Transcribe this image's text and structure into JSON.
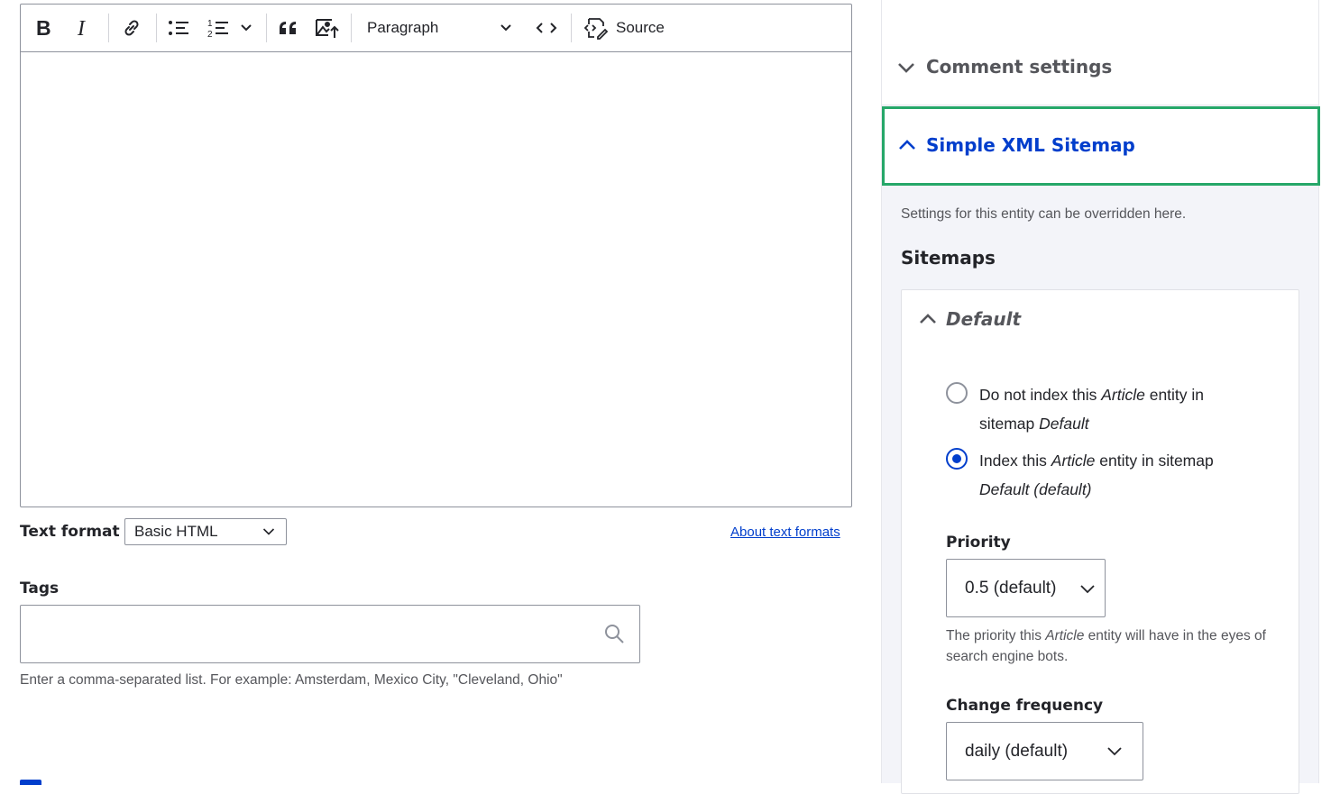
{
  "editor": {
    "toolbar": {
      "paragraph_label": "Paragraph",
      "source_label": "Source",
      "icons": [
        "bold-icon",
        "italic-icon",
        "link-icon",
        "bulleted-list-icon",
        "numbered-list-icon",
        "chevron-down-icon",
        "blockquote-icon",
        "image-upload-icon",
        "chevron-down-icon",
        "code-icon",
        "source-icon"
      ]
    }
  },
  "text_format": {
    "label": "Text format",
    "selected": "Basic HTML",
    "about_link": "About text formats"
  },
  "tags": {
    "label": "Tags",
    "value": "",
    "description": "Enter a comma-separated list. For example: Amsterdam, Mexico City, \"Cleveland, Ohio\""
  },
  "sidebar": {
    "comment_settings": {
      "title": "Comment settings"
    },
    "simple_xml_sitemap": {
      "title": "Simple XML Sitemap",
      "description": "Settings for this entity can be overridden here.",
      "sitemaps_heading": "Sitemaps",
      "default_group": {
        "title": "Default",
        "radio_options": [
          {
            "pre": "Do not index this ",
            "entity": "Article",
            "mid": " entity in sitemap ",
            "sitemap": "Default",
            "post": "",
            "checked": false
          },
          {
            "pre": "Index this ",
            "entity": "Article",
            "mid": " entity in sitemap ",
            "sitemap": "Default (default)",
            "post": "",
            "checked": true
          }
        ],
        "priority": {
          "label": "Priority",
          "selected": "0.5 (default)",
          "desc_pre": "The priority this ",
          "desc_entity": "Article",
          "desc_post": " entity will have in the eyes of search engine bots."
        },
        "change_frequency": {
          "label": "Change frequency",
          "selected": "daily (default)"
        }
      }
    }
  },
  "colors": {
    "accent_blue": "#003ecc",
    "focus_green": "#26a769",
    "sidebar_bg": "#f3f4f9"
  }
}
